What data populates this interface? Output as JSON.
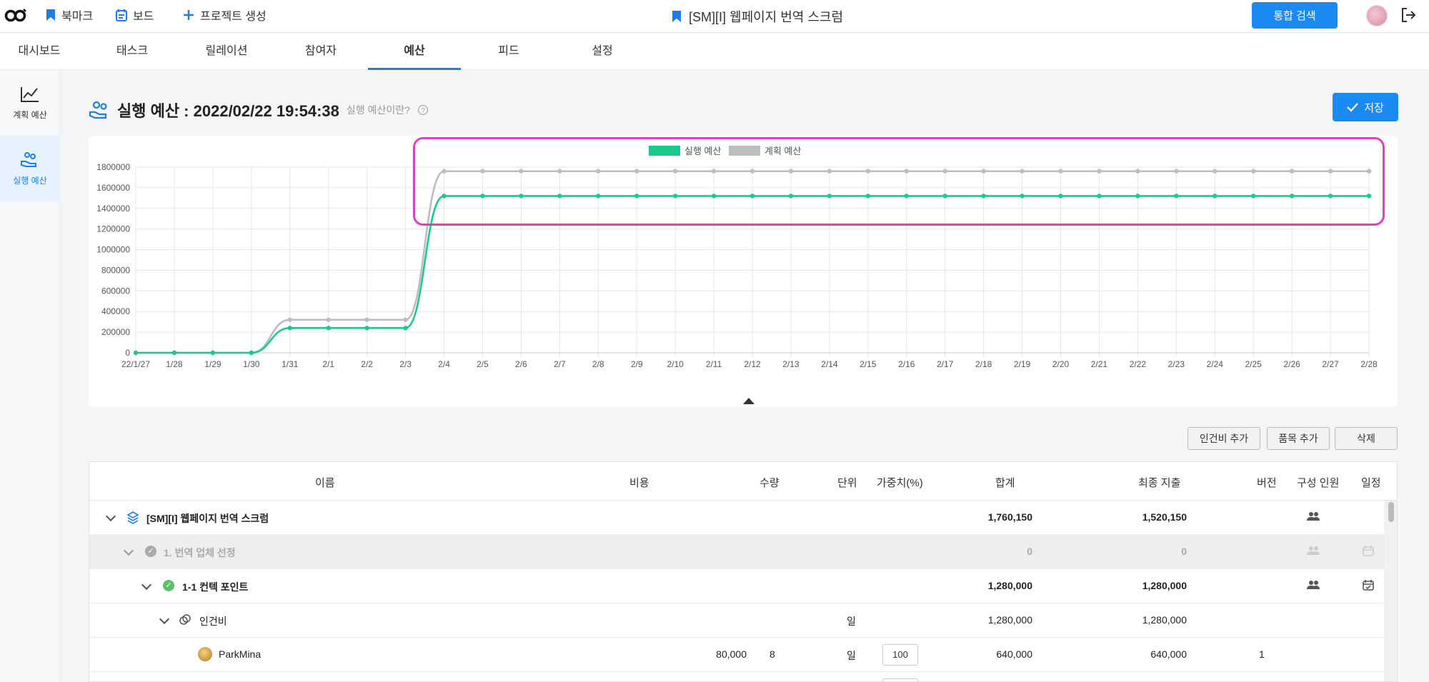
{
  "topbar": {
    "bookmark_label": "북마크",
    "board_label": "보드",
    "create_project_label": "프로젝트 생성",
    "project_title": "[SM][I] 웹페이지 번역 스크럼",
    "search_button": "통합 검색"
  },
  "tabs": [
    {
      "label": "대시보드"
    },
    {
      "label": "태스크"
    },
    {
      "label": "릴레이션"
    },
    {
      "label": "참여자"
    },
    {
      "label": "예산"
    },
    {
      "label": "피드"
    },
    {
      "label": "설정"
    }
  ],
  "sidebar": {
    "items": [
      {
        "label": "계획 예산"
      },
      {
        "label": "실행 예산"
      }
    ]
  },
  "header": {
    "title": "실행 예산 : 2022/02/22 19:54:38",
    "help_text": "실행 예산이란?",
    "save_label": "저장"
  },
  "colors": {
    "accent": "#1b8af2",
    "execution": "#1dc98a",
    "plan": "#bdbdbd"
  },
  "chart_data": {
    "type": "line",
    "x": [
      "22/1/27",
      "1/28",
      "1/29",
      "1/30",
      "1/31",
      "2/1",
      "2/2",
      "2/3",
      "2/4",
      "2/5",
      "2/6",
      "2/7",
      "2/8",
      "2/9",
      "2/10",
      "2/11",
      "2/12",
      "2/13",
      "2/14",
      "2/15",
      "2/16",
      "2/17",
      "2/18",
      "2/19",
      "2/20",
      "2/21",
      "2/22",
      "2/23",
      "2/24",
      "2/25",
      "2/26",
      "2/27",
      "2/28"
    ],
    "series": [
      {
        "name": "실행 예산",
        "color": "#1dc98a",
        "values": [
          0,
          0,
          0,
          0,
          240000,
          240000,
          240000,
          240000,
          1520150,
          1520150,
          1520150,
          1520150,
          1520150,
          1520150,
          1520150,
          1520150,
          1520150,
          1520150,
          1520150,
          1520150,
          1520150,
          1520150,
          1520150,
          1520150,
          1520150,
          1520150,
          1520150,
          1520150,
          1520150,
          1520150,
          1520150,
          1520150,
          1520150
        ]
      },
      {
        "name": "계획 예산",
        "color": "#bdbdbd",
        "values": [
          0,
          0,
          0,
          0,
          320000,
          320000,
          320000,
          320000,
          1760150,
          1760150,
          1760150,
          1760150,
          1760150,
          1760150,
          1760150,
          1760150,
          1760150,
          1760150,
          1760150,
          1760150,
          1760150,
          1760150,
          1760150,
          1760150,
          1760150,
          1760150,
          1760150,
          1760150,
          1760150,
          1760150,
          1760150,
          1760150,
          1760150
        ]
      }
    ],
    "yticks": [
      "0",
      "200000",
      "400000",
      "600000",
      "800000",
      "1000000",
      "1200000",
      "1400000",
      "1600000",
      "1800000"
    ],
    "ylim": [
      0,
      1800000
    ],
    "grid": true,
    "legend": "top-center"
  },
  "actions": {
    "add_labor": "인건비 추가",
    "add_item": "품목 추가",
    "delete": "삭제"
  },
  "table": {
    "headers": {
      "name": "이름",
      "cost": "비용",
      "qty": "수량",
      "unit": "단위",
      "weight": "가중치(%)",
      "total": "합계",
      "final": "최종 지출",
      "version": "버전",
      "members": "구성 인원",
      "schedule": "일정"
    },
    "rows": [
      {
        "name": "[SM][I] 웹페이지 번역 스크럼",
        "total": "1,760,150",
        "final": "1,520,150"
      },
      {
        "name": "1. 번역 업체 선정",
        "total": "0",
        "final": "0"
      },
      {
        "name": "1-1 컨텍 포인트",
        "total": "1,280,000",
        "final": "1,280,000"
      },
      {
        "name": "인건비",
        "unit": "일",
        "total": "1,280,000",
        "final": "1,280,000"
      },
      {
        "name": "ParkMina",
        "cost": "80,000",
        "qty": "8",
        "unit": "일",
        "weight": "100",
        "total": "640,000",
        "final": "640,000",
        "version": "1"
      }
    ]
  }
}
